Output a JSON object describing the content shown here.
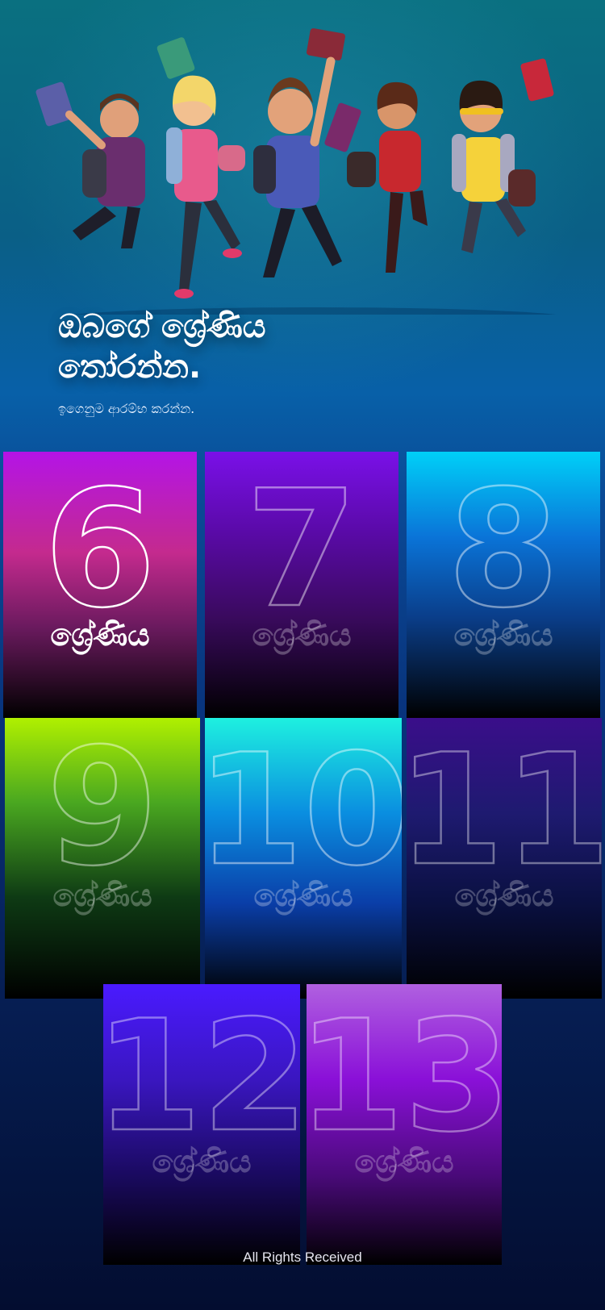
{
  "hero": {
    "headline": "ඔබගේ ශ්‍රේණිය\nතෝරන්න.",
    "subline": "ඉගෙනුම ආරම්භ කරන්න."
  },
  "grades": [
    {
      "number": "6",
      "label": "ශ්‍රේණිය",
      "active": true
    },
    {
      "number": "7",
      "label": "ශ්‍රේණිය",
      "active": false
    },
    {
      "number": "8",
      "label": "ශ්‍රේණිය",
      "active": false
    },
    {
      "number": "9",
      "label": "ශ්‍රේණිය",
      "active": false
    },
    {
      "number": "10",
      "label": "ශ්‍රේණිය",
      "active": false
    },
    {
      "number": "11",
      "label": "ශ්‍රේණිය",
      "active": false
    },
    {
      "number": "12",
      "label": "ශ්‍රේණිය",
      "active": false
    },
    {
      "number": "13",
      "label": "ශ්‍රේණිය",
      "active": false
    }
  ],
  "footer": {
    "text": "All Rights Received"
  }
}
